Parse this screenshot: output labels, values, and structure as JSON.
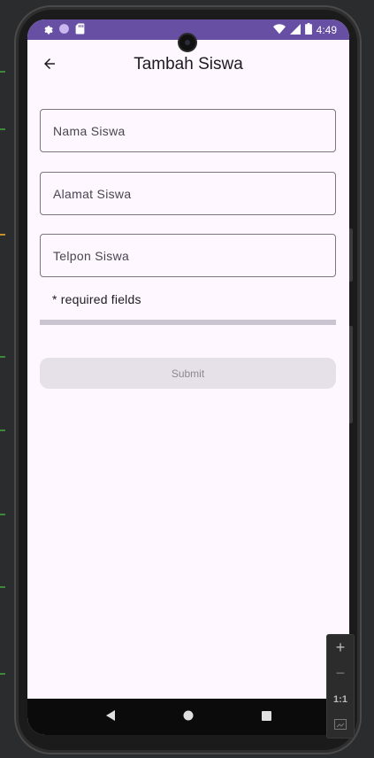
{
  "status_bar": {
    "time": "4:49",
    "icons": [
      "settings-icon",
      "circle-icon",
      "sd-card-icon",
      "wifi-icon",
      "signal-icon",
      "battery-icon"
    ],
    "color": "#6750a4"
  },
  "app_bar": {
    "title": "Tambah Siswa",
    "back_icon": "arrow-left-icon"
  },
  "form": {
    "name_placeholder": "Nama Siswa",
    "name_value": "",
    "address_placeholder": "Alamat Siswa",
    "address_value": "",
    "phone_placeholder": "Telpon Siswa",
    "phone_value": "",
    "required_note": "* required fields",
    "progress_fraction": 0,
    "submit_label": "Submit"
  },
  "nav_bar": {
    "buttons": [
      "back-triangle-icon",
      "home-circle-icon",
      "recents-square-icon"
    ]
  },
  "zoom_controls": {
    "zoom_in_label": "+",
    "zoom_out_label": "−",
    "actual_size_label": "1:1",
    "fit_icon": "fit-screen-icon"
  },
  "colors": {
    "primary": "#6750a4",
    "background": "#fef7ff",
    "outline": "#7a757f",
    "disabled_button": "#e6e0e9"
  }
}
